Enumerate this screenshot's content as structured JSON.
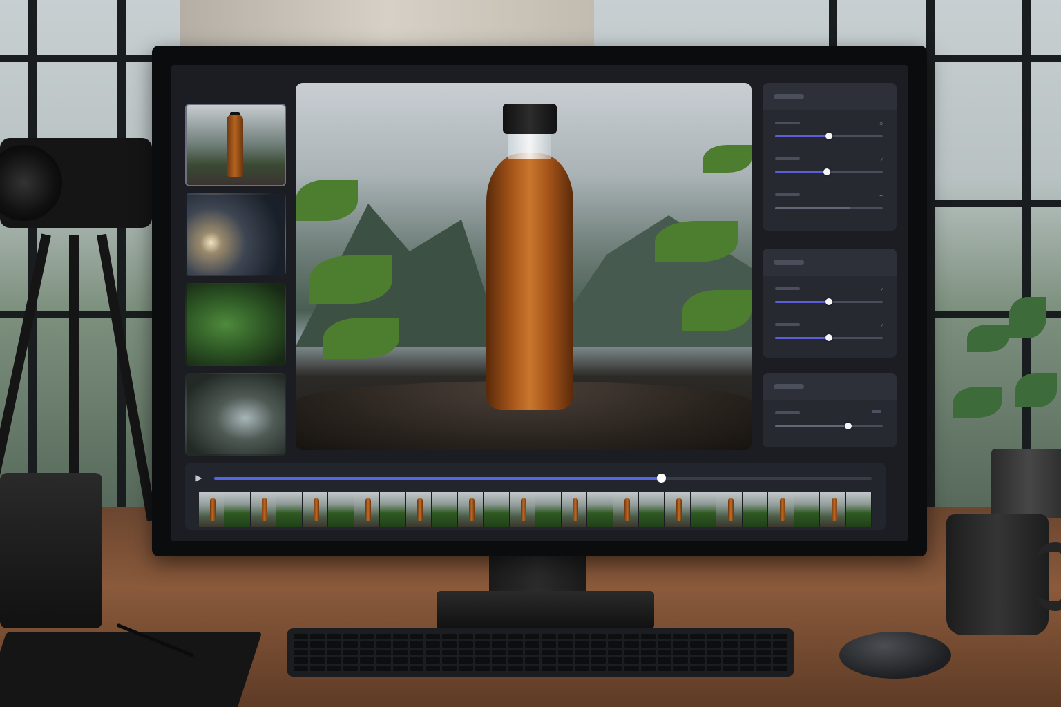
{
  "app": {
    "panels": [
      {
        "title": "",
        "rows": [
          {
            "label": "",
            "icon": "drop-icon",
            "value": 0.5,
            "accent": true
          },
          {
            "label": "",
            "icon": "brush-icon",
            "value": 0.48,
            "accent": true
          },
          {
            "label": "",
            "icon": "leaf-icon",
            "value": 0.7,
            "accent": false
          }
        ]
      },
      {
        "title": "",
        "rows": [
          {
            "label": "",
            "icon": "wand-icon",
            "value": 0.5,
            "accent": true
          },
          {
            "label": "",
            "icon": "pencil-icon",
            "value": 0.5,
            "accent": true
          }
        ]
      },
      {
        "title": "",
        "rows": [
          {
            "label": "",
            "icon": "",
            "value": 0.68,
            "accent": false
          }
        ]
      }
    ],
    "thumbnails": [
      "bottle-scene",
      "water-splash",
      "green-leaves",
      "rocky-stream"
    ],
    "active_thumbnail": 0,
    "timeline": {
      "playhead": 0.68,
      "frames": [
        "bottle",
        "tree",
        "bottle",
        "tree",
        "bottle",
        "tree",
        "bottle",
        "tree",
        "bottle",
        "tree",
        "bottle",
        "tree",
        "bottle",
        "tree",
        "bottle",
        "tree",
        "bottle",
        "tree",
        "bottle",
        "tree",
        "bottle",
        "tree",
        "bottle",
        "tree",
        "bottle",
        "tree"
      ]
    },
    "colors": {
      "accent": "#5b5ed8",
      "scrub": "#5268e0",
      "panel": "#262930",
      "background": "#1b1d22"
    }
  }
}
